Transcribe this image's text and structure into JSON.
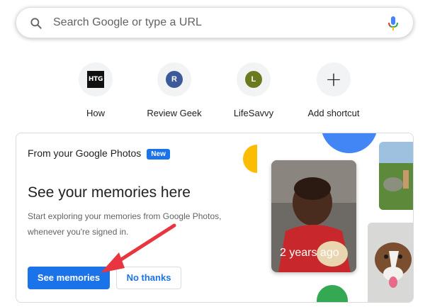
{
  "search": {
    "placeholder": "Search Google or type a URL"
  },
  "shortcuts": [
    {
      "label": "How",
      "icon": "htg-favicon",
      "icon_text": "HTG"
    },
    {
      "label": "Review Geek",
      "icon": "review-geek-favicon",
      "icon_text": "R",
      "color": "#3c5a99"
    },
    {
      "label": "LifeSavvy",
      "icon": "lifesavvy-favicon",
      "icon_text": "L",
      "color": "#6b7a1e"
    },
    {
      "label": "Add shortcut",
      "icon": "plus-icon"
    }
  ],
  "card": {
    "header": "From your Google Photos",
    "badge": "New",
    "title": "See your memories here",
    "description": "Start exploring your memories from Google Photos, whenever you're signed in.",
    "primary_button": "See memories",
    "secondary_button": "No thanks",
    "photo_caption": "2 years ago"
  },
  "colors": {
    "accent_blue": "#1a73e8",
    "annotation_red": "#e8353f",
    "google_yellow": "#fbbc04",
    "google_green": "#34a853",
    "google_blue": "#4285f4"
  }
}
